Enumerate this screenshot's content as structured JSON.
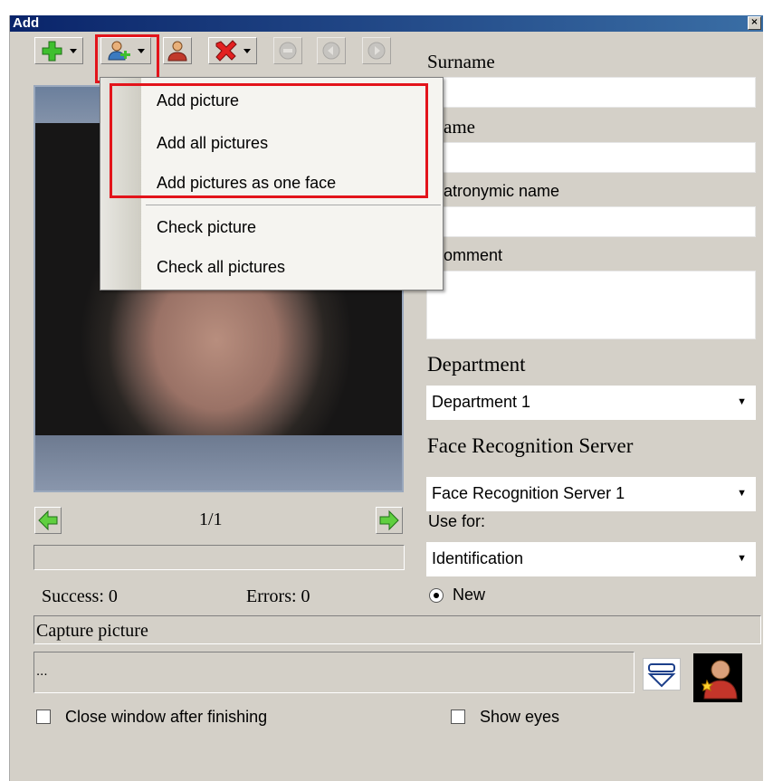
{
  "window": {
    "title": "Add",
    "close_label": "×"
  },
  "toolbar": [
    {
      "name": "add-button",
      "icon": "green-plus-icon",
      "dropdown": true
    },
    {
      "name": "add-picture-button",
      "icon": "person-add-icon",
      "dropdown": true
    },
    {
      "name": "person-button",
      "icon": "person-icon",
      "dropdown": false
    },
    {
      "name": "delete-button",
      "icon": "red-x-icon",
      "dropdown": true
    },
    {
      "name": "stop-button",
      "icon": "stop-icon",
      "dropdown": false,
      "disabled": true
    },
    {
      "name": "back-button",
      "icon": "circle-left-icon",
      "dropdown": false,
      "disabled": true
    },
    {
      "name": "forward-button",
      "icon": "circle-right-icon",
      "dropdown": false,
      "disabled": true
    }
  ],
  "menu": {
    "items": [
      {
        "label": "Add picture"
      },
      {
        "label": "Add all pictures"
      },
      {
        "label": "Add pictures as one face"
      },
      {
        "label": "Check picture"
      },
      {
        "label": "Check all pictures"
      }
    ]
  },
  "form": {
    "surname_label": "Surname",
    "name_label": "ame",
    "patronymic_label": "atronymic name",
    "comment_label": "omment",
    "department_label": "Department",
    "department_value": "Department 1",
    "server_label": "Face Recognition Server",
    "server_value": "Face Recognition Server 1",
    "use_for_label": "Use for:",
    "use_for_value": "Identification",
    "new_label": "New"
  },
  "nav": {
    "page": "1/1"
  },
  "stats": {
    "success": "Success: 0",
    "errors": "Errors: 0"
  },
  "capture_label": "Capture picture",
  "path_value": "...",
  "options": {
    "close_window": "Close window after finishing",
    "show_eyes": "Show eyes"
  }
}
